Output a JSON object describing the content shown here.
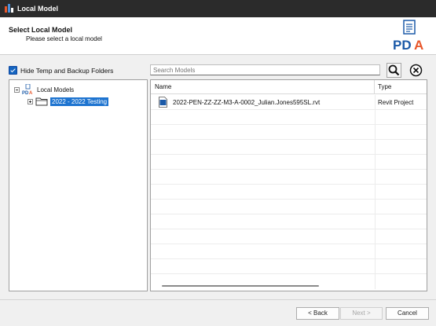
{
  "window": {
    "title": "Local Model"
  },
  "header": {
    "title": "Select Local Model",
    "subtitle": "Please select a local model",
    "logo_text": "PDA"
  },
  "options": {
    "hide_temp_label": "Hide Temp and Backup Folders",
    "hide_temp_checked": true
  },
  "search": {
    "placeholder": "Search Models"
  },
  "tree": {
    "root": {
      "label": "Local Models",
      "icon": "pda-small-icon"
    },
    "children": [
      {
        "label": "2022 - 2022 Testing",
        "selected": true,
        "icon": "folder-icon"
      }
    ]
  },
  "list": {
    "columns": [
      "Name",
      "Type"
    ],
    "rows": [
      {
        "name": "2022-PEN-ZZ-ZZ-M3-A-0002_Julian.Jones595SL.rvt",
        "type": "Revit Project",
        "icon": "rvt-file-icon"
      }
    ]
  },
  "footer": {
    "back_label": "< Back",
    "next_label": "Next >",
    "cancel_label": "Cancel"
  },
  "colors": {
    "accent": "#1e74d0",
    "logo_orange": "#e8562a",
    "logo_blue": "#1b5aa8"
  }
}
